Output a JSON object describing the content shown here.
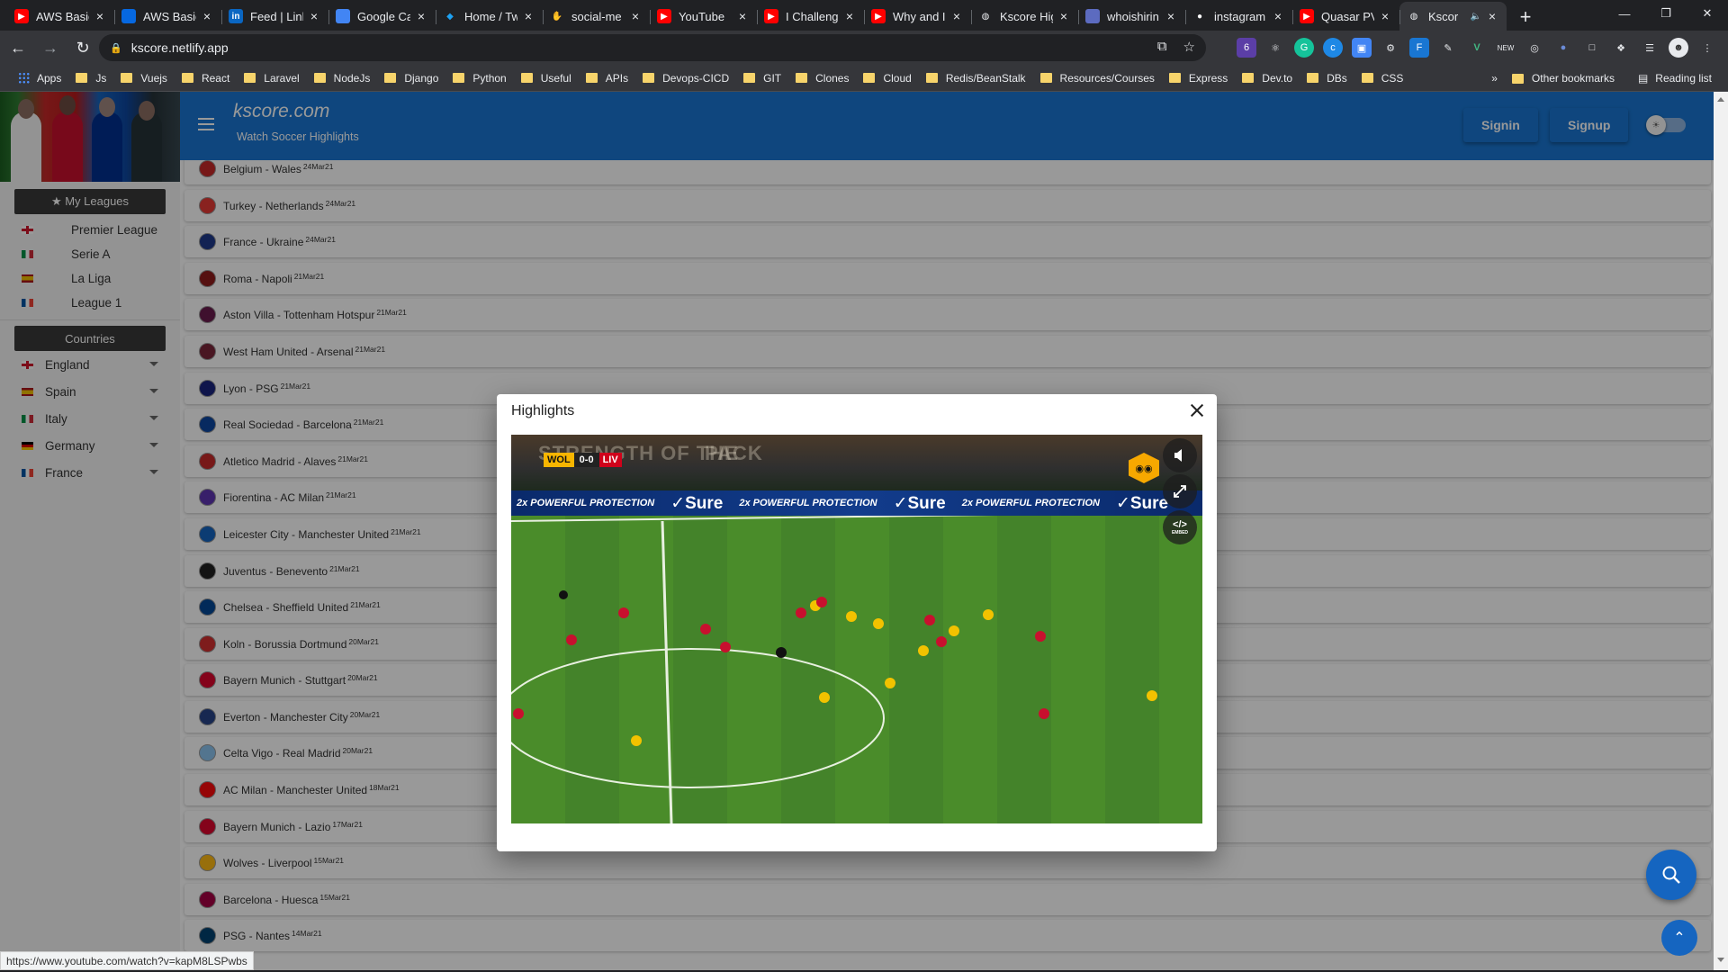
{
  "browser": {
    "tabs": [
      {
        "title": "AWS Basic",
        "icon": "youtube-icon",
        "color": "#ff0000"
      },
      {
        "title": "AWS Basic",
        "icon": "meta-icon",
        "color": "#0668e1"
      },
      {
        "title": "Feed | Link",
        "icon": "linkedin-icon",
        "color": "#0a66c2"
      },
      {
        "title": "Google Ca",
        "icon": "google-calendar-icon",
        "color": "#4285f4"
      },
      {
        "title": "Home / Tw",
        "icon": "twitter-icon",
        "color": "#1da1f2"
      },
      {
        "title": "social-me",
        "icon": "hand-icon",
        "color": "#f4b400"
      },
      {
        "title": "YouTube",
        "icon": "youtube-icon",
        "color": "#ff0000"
      },
      {
        "title": "I Challeng",
        "icon": "youtube-icon",
        "color": "#ff0000"
      },
      {
        "title": "Why and I",
        "icon": "youtube-icon",
        "color": "#ff0000"
      },
      {
        "title": "Kscore Hig",
        "icon": "globe-icon",
        "color": "#9aa0a6"
      },
      {
        "title": "whoishirin",
        "icon": "site-icon",
        "color": "#5c6bc0"
      },
      {
        "title": "instagram",
        "icon": "github-icon",
        "color": "#ffffff"
      },
      {
        "title": "Quasar PV",
        "icon": "youtube-icon",
        "color": "#ff0000"
      },
      {
        "title": "Kscor",
        "icon": "globe-icon",
        "color": "#9aa0a6",
        "active": true
      }
    ],
    "url": "kscore.netlify.app",
    "bookmarks": [
      "Apps",
      "Js",
      "Vuejs",
      "React",
      "Laravel",
      "NodeJs",
      "Django",
      "Python",
      "Useful",
      "APIs",
      "Devops-CICD",
      "GIT",
      "Clones",
      "Cloud",
      "Redis/BeanStalk",
      "Resources/Courses",
      "Express",
      "Dev.to",
      "DBs",
      "CSS"
    ],
    "bookmarks_more": "»",
    "other_bookmarks": "Other bookmarks",
    "reading_list": "Reading list",
    "status_url": "https://www.youtube.com/watch?v=kapM8LSPwbs"
  },
  "header": {
    "title": "kscore.com",
    "subtitle": "Watch Soccer Highlights",
    "signin": "Signin",
    "signup": "Signup",
    "accent": "#1976d2"
  },
  "sidebar": {
    "my_leagues_label": "★ My Leagues",
    "leagues": [
      {
        "name": "Premier League",
        "flag": "flag-eng"
      },
      {
        "name": "Serie A",
        "flag": "flag-ita"
      },
      {
        "name": "La Liga",
        "flag": "flag-esp"
      },
      {
        "name": "League 1",
        "flag": "flag-fra"
      }
    ],
    "countries_label": "Countries",
    "countries": [
      {
        "name": "England",
        "flag": "flag-eng"
      },
      {
        "name": "Spain",
        "flag": "flag-esp"
      },
      {
        "name": "Italy",
        "flag": "flag-ita"
      },
      {
        "name": "Germany",
        "flag": "flag-ger"
      },
      {
        "name": "France",
        "flag": "flag-fra"
      }
    ]
  },
  "matches": [
    {
      "title": "Belgium - Wales",
      "date": "24Mar21",
      "crest": "#c62828"
    },
    {
      "title": "Turkey - Netherlands",
      "date": "24Mar21",
      "crest": "#e53935"
    },
    {
      "title": "France - Ukraine",
      "date": "24Mar21",
      "crest": "#1e3a8a"
    },
    {
      "title": "Roma - Napoli",
      "date": "21Mar21",
      "crest": "#8e1b1b"
    },
    {
      "title": "Aston Villa - Tottenham Hotspur",
      "date": "21Mar21",
      "crest": "#6a1b4d"
    },
    {
      "title": "West Ham United - Arsenal",
      "date": "21Mar21",
      "crest": "#7a263a"
    },
    {
      "title": "Lyon - PSG",
      "date": "21Mar21",
      "crest": "#1a237e"
    },
    {
      "title": "Real Sociedad - Barcelona",
      "date": "21Mar21",
      "crest": "#0d47a1"
    },
    {
      "title": "Atletico Madrid - Alaves",
      "date": "21Mar21",
      "crest": "#c62828"
    },
    {
      "title": "Fiorentina - AC Milan",
      "date": "21Mar21",
      "crest": "#5e35b1"
    },
    {
      "title": "Leicester City - Manchester United",
      "date": "21Mar21",
      "crest": "#1565c0"
    },
    {
      "title": "Juventus - Benevento",
      "date": "21Mar21",
      "crest": "#212121"
    },
    {
      "title": "Chelsea - Sheffield United",
      "date": "21Mar21",
      "crest": "#034694"
    },
    {
      "title": "Koln - Borussia Dortmund",
      "date": "20Mar21",
      "crest": "#d32f2f"
    },
    {
      "title": "Bayern Munich - Stuttgart",
      "date": "20Mar21",
      "crest": "#dc052d"
    },
    {
      "title": "Everton - Manchester City",
      "date": "20Mar21",
      "crest": "#274488"
    },
    {
      "title": "Celta Vigo - Real Madrid",
      "date": "20Mar21",
      "crest": "#8ac3ee"
    },
    {
      "title": "AC Milan - Manchester United",
      "date": "18Mar21",
      "crest": "#fb090b"
    },
    {
      "title": "Bayern Munich - Lazio",
      "date": "17Mar21",
      "crest": "#dc052d"
    },
    {
      "title": "Wolves - Liverpool",
      "date": "15Mar21",
      "crest": "#fdb913"
    },
    {
      "title": "Barcelona - Huesca",
      "date": "15Mar21",
      "crest": "#a50044"
    },
    {
      "title": "PSG - Nantes",
      "date": "14Mar21",
      "crest": "#004170"
    }
  ],
  "modal": {
    "title": "Highlights",
    "video": {
      "home": "WOL",
      "score": "0-0",
      "away": "LIV",
      "stand_text_left": "STRENGTH OF THE",
      "stand_text_right": "PACK",
      "ad_small": "2x POWERFUL PROTECTION",
      "ad_brand": "✓Sure",
      "embed_label": "EMBED"
    }
  }
}
